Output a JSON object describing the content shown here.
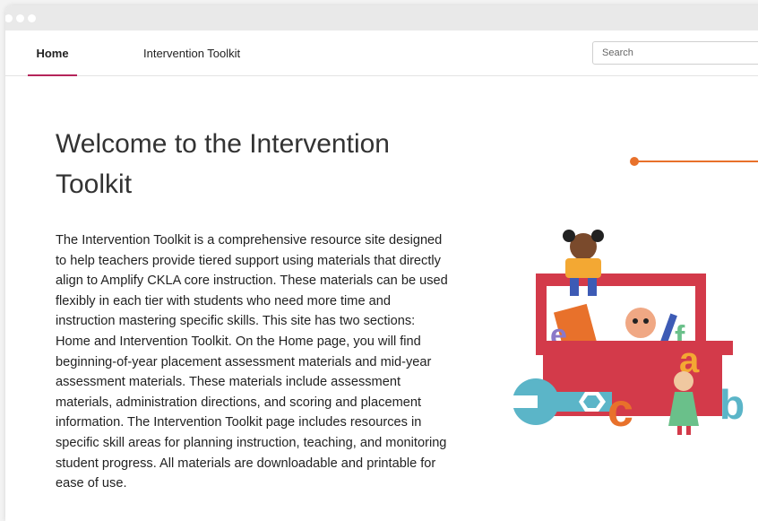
{
  "nav": {
    "tabs": [
      {
        "label": "Home",
        "active": true
      },
      {
        "label": "Intervention Toolkit",
        "active": false
      }
    ],
    "search_placeholder": "Search"
  },
  "main": {
    "title": "Welcome to the Intervention Toolkit",
    "description": "The Intervention Toolkit is a comprehensive resource site designed to help teachers provide tiered support using materials that directly align to Amplify CKLA core instruction. These materials can be used flexibly in each tier with students who need more time and instruction mastering specific skills. This site has two sections: Home and Intervention Toolkit. On the Home page, you will find beginning-of-year placement assessment materials and mid-year assessment materials. These materials include assessment materials, administration directions, and scoring and placement information. The Intervention Toolkit page includes resources in specific skill areas for planning instruction, teaching, and monitoring student progress. All materials are downloadable and printable for ease of use."
  },
  "colors": {
    "accent": "#b5245a",
    "toolbox_red": "#d33a4a",
    "slider_orange": "#e8712b",
    "wrench_teal": "#5bb5c8"
  },
  "icons": [
    "toolbox-illustration",
    "wrench-icon"
  ]
}
